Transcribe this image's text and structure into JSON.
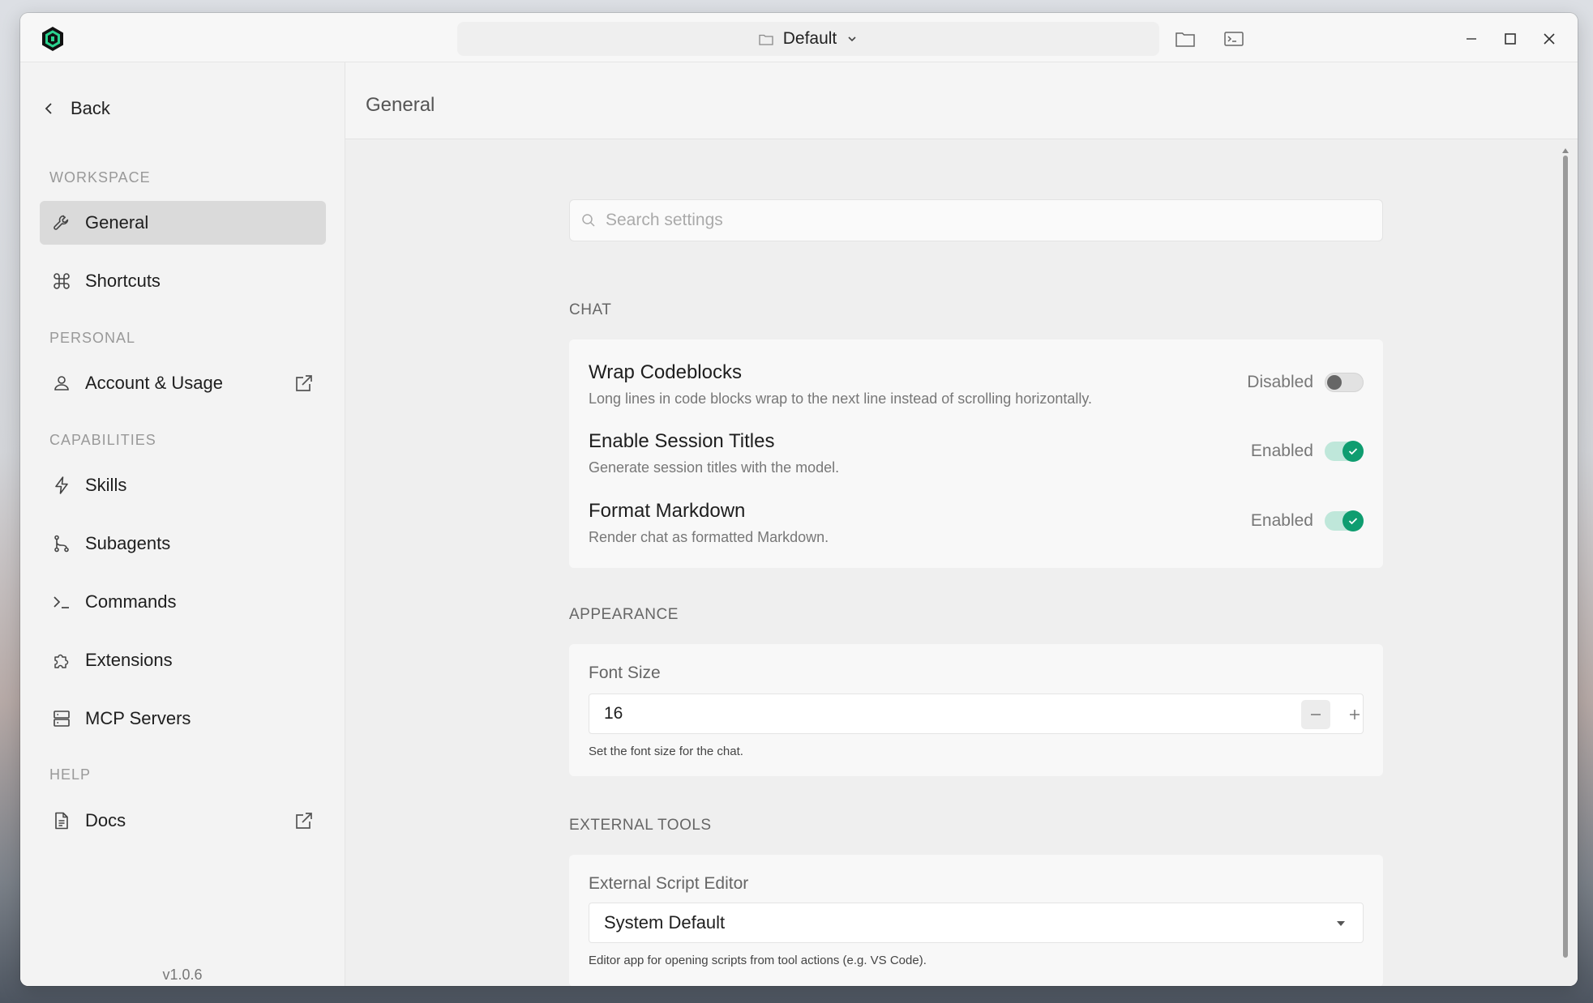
{
  "titlebar": {
    "workspace": "Default"
  },
  "sidebar": {
    "back_label": "Back",
    "sections": {
      "workspace": "WORKSPACE",
      "personal": "PERSONAL",
      "capabilities": "CAPABILITIES",
      "help": "HELP"
    },
    "items": {
      "general": "General",
      "shortcuts": "Shortcuts",
      "account": "Account & Usage",
      "skills": "Skills",
      "subagents": "Subagents",
      "commands": "Commands",
      "extensions": "Extensions",
      "mcp": "MCP Servers",
      "docs": "Docs"
    },
    "version": "v1.0.6"
  },
  "main": {
    "title": "General",
    "search_placeholder": "Search settings",
    "chat": {
      "title": "CHAT",
      "settings": [
        {
          "name": "Wrap Codeblocks",
          "desc": "Long lines in code blocks wrap to the next line instead of scrolling horizontally.",
          "state": "Disabled"
        },
        {
          "name": "Enable Session Titles",
          "desc": "Generate session titles with the model.",
          "state": "Enabled"
        },
        {
          "name": "Format Markdown",
          "desc": "Render chat as formatted Markdown.",
          "state": "Enabled"
        }
      ]
    },
    "appearance": {
      "title": "APPEARANCE",
      "font_size_label": "Font Size",
      "font_size_value": "16",
      "font_size_help": "Set the font size for the chat."
    },
    "external_tools": {
      "title": "EXTERNAL TOOLS",
      "editor_label": "External Script Editor",
      "editor_value": "System Default",
      "editor_help": "Editor app for opening scripts from tool actions (e.g. VS Code)."
    }
  },
  "colors": {
    "accent": "#0f9d70",
    "accent_track": "#bfe7da",
    "active_nav": "#dadada"
  }
}
